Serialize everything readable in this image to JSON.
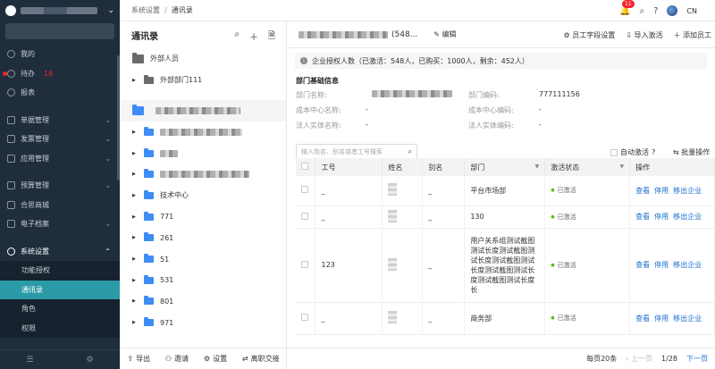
{
  "sidebar": {
    "items_top": [
      {
        "label": "我的",
        "icon": "user-icon"
      },
      {
        "label": "待办",
        "badge": "16",
        "icon": "todo-icon"
      },
      {
        "label": "报表",
        "icon": "report-icon"
      }
    ],
    "items_mid": [
      {
        "label": "单据管理",
        "icon": "document-icon"
      },
      {
        "label": "发票管理",
        "icon": "invoice-icon"
      },
      {
        "label": "应用管理",
        "icon": "app-icon"
      }
    ],
    "items_low": [
      {
        "label": "预算管理",
        "icon": "budget-icon"
      },
      {
        "label": "合思商城",
        "icon": "mall-icon"
      },
      {
        "label": "电子档案",
        "icon": "archive-icon"
      }
    ],
    "settings": {
      "label": "系统设置",
      "icon": "settings-icon"
    },
    "sub_items": [
      "功能授权",
      "通讯录",
      "角色",
      "权限"
    ],
    "active_sub": "通讯录"
  },
  "topbar": {
    "breadcrumb": [
      "系统设置",
      "通讯录"
    ],
    "notif_count": "11",
    "lang": "CN"
  },
  "contacts": {
    "title": "通讯录",
    "external": "外部人员",
    "external_dept": "外部部门111",
    "folders": [
      "技术中心",
      "771",
      "261",
      "51",
      "531",
      "801",
      "971"
    ],
    "footer": {
      "export": "导出",
      "invite": "邀请",
      "settings": "设置",
      "handover": "离职交接"
    }
  },
  "main": {
    "dept_count": "(548...",
    "edit": "编辑",
    "actions": {
      "fields": "员工字段设置",
      "import": "导入激活",
      "add": "添加员工"
    },
    "notice": "企业授权人数（已激活：548人，已购买：1000人，剩余：452人）",
    "section_title": "部门基础信息",
    "info": {
      "dept_name_k": "部门名称:",
      "dept_code_k": "部门编码:",
      "dept_code_v": "777111156",
      "cost_name_k": "成本中心名称:",
      "cost_name_v": "-",
      "cost_code_k": "成本中心编码:",
      "cost_code_v": "-",
      "legal_name_k": "法人实体名称:",
      "legal_name_v": "-",
      "legal_code_k": "法人实体编码:",
      "legal_code_v": "-"
    },
    "search_placeholder": "输入姓名、别名或者工号搜索",
    "auto_activate": "自动激活",
    "batch": "批量操作",
    "columns": [
      "工号",
      "姓名",
      "别名",
      "部门",
      "激活状态",
      "操作"
    ],
    "rows": [
      {
        "id": "_",
        "alias": "_",
        "dept": "平台市场部",
        "status": "已激活"
      },
      {
        "id": "_",
        "alias": "_",
        "dept": "130",
        "status": "已激活"
      },
      {
        "id": "123",
        "alias": "_",
        "dept": "用户关系组测试截图测试长度测试截图测试长度测试截图测试长度测试截图测试长度测试截图测试长度长",
        "status": "已激活"
      },
      {
        "id": "_",
        "alias": "_",
        "dept": "商务部",
        "status": "已激活"
      }
    ],
    "ops": [
      "查看",
      "停用",
      "移出企业"
    ],
    "pager": {
      "size": "每页20条",
      "prev": "上一页",
      "page": "1/28",
      "next": "下一页"
    }
  }
}
